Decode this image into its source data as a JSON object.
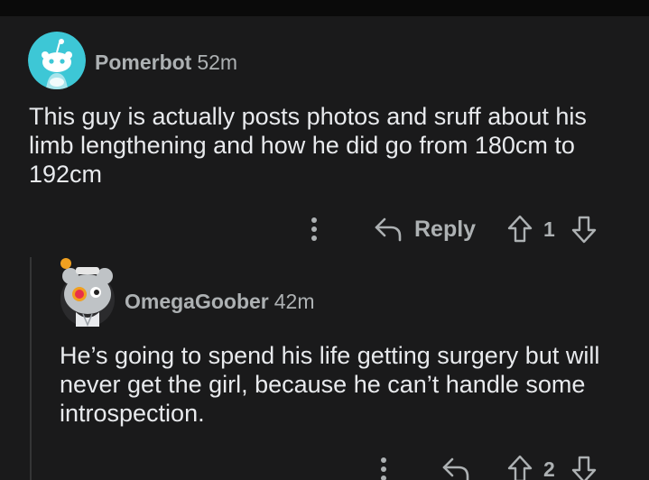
{
  "comments": [
    {
      "author": "Pomerbot",
      "time": "52m",
      "body": "This guy is actually posts photos and sruff about his limb lengthening and how he did go from 180cm to 192cm",
      "actions": {
        "more_icon": "more-vertical-icon",
        "reply_label": "Reply",
        "upvote_icon": "upvote-arrow-icon",
        "vote_count": "1",
        "downvote_icon": "downvote-arrow-icon"
      },
      "avatar_color": "#3dc7d6"
    },
    {
      "author": "OmegaGoober",
      "time": "42m",
      "body": "He’s going to spend his life getting surgery but will never get the girl, because he can’t handle some introspection.",
      "actions": {
        "more_icon": "more-vertical-icon",
        "reply_icon": "reply-arrow-icon",
        "upvote_icon": "upvote-arrow-icon",
        "vote_count": "2",
        "downvote_icon": "downvote-arrow-icon"
      },
      "avatar_color": "#bfc3c6"
    }
  ],
  "colors": {
    "background": "#1a1a1b",
    "text_primary": "#e8eaed",
    "text_secondary": "#adb1b3",
    "thread_line": "#343536"
  }
}
